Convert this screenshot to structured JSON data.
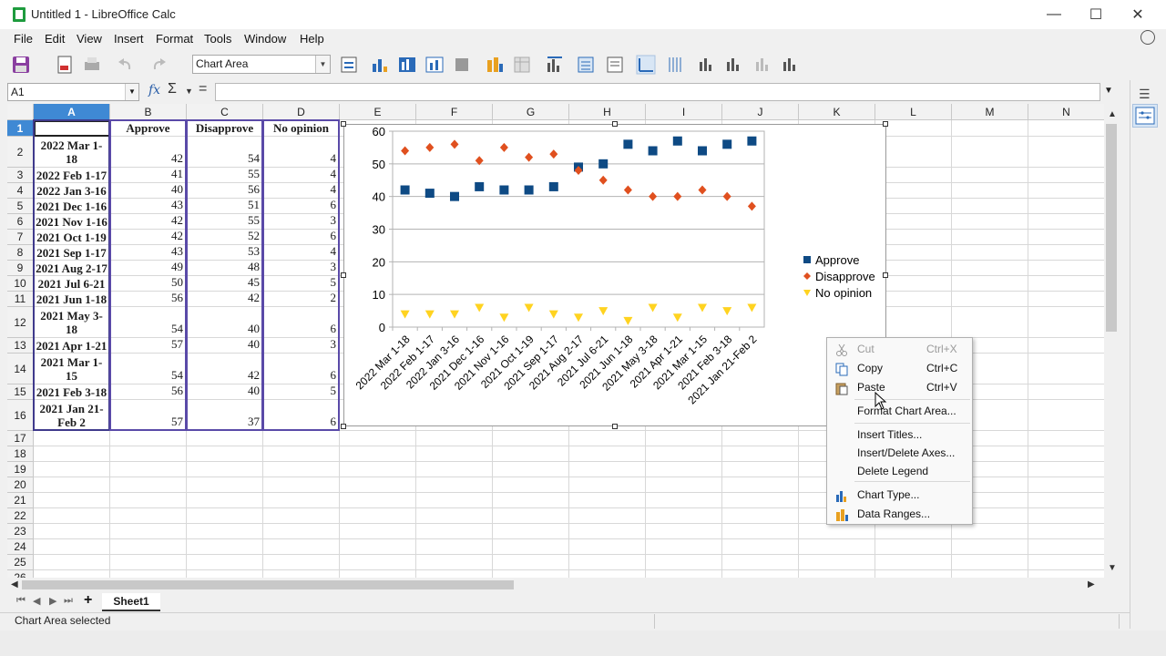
{
  "window": {
    "title": "Untitled 1 - LibreOffice Calc"
  },
  "menu": [
    "File",
    "Edit",
    "View",
    "Insert",
    "Format",
    "Tools",
    "Window",
    "Help"
  ],
  "toolbar": {
    "chart_element_select": "Chart Area"
  },
  "formula": {
    "cell_ref": "A1",
    "fx": "fx",
    "sigma": "Σ",
    "eq": "=",
    "content": ""
  },
  "columns": [
    "A",
    "B",
    "C",
    "D",
    "E",
    "F",
    "G",
    "H",
    "I",
    "J",
    "K",
    "L",
    "M",
    "N"
  ],
  "rows": [
    "1",
    "2",
    "3",
    "4",
    "5",
    "6",
    "7",
    "8",
    "9",
    "10",
    "11",
    "12",
    "13",
    "14",
    "15",
    "16",
    "17",
    "18",
    "19",
    "20",
    "21",
    "22",
    "23",
    "24",
    "25",
    "26"
  ],
  "table": {
    "headers": [
      "Approve",
      "Disapprove",
      "No opinion"
    ],
    "rows": [
      {
        "date": "2022 Mar 1-18",
        "approve": "42",
        "disapprove": "54",
        "no_opinion": "4"
      },
      {
        "date": "2022 Feb 1-17",
        "approve": "41",
        "disapprove": "55",
        "no_opinion": "4"
      },
      {
        "date": "2022 Jan 3-16",
        "approve": "40",
        "disapprove": "56",
        "no_opinion": "4"
      },
      {
        "date": "2021 Dec 1-16",
        "approve": "43",
        "disapprove": "51",
        "no_opinion": "6"
      },
      {
        "date": "2021 Nov 1-16",
        "approve": "42",
        "disapprove": "55",
        "no_opinion": "3"
      },
      {
        "date": "2021 Oct 1-19",
        "approve": "42",
        "disapprove": "52",
        "no_opinion": "6"
      },
      {
        "date": "2021 Sep 1-17",
        "approve": "43",
        "disapprove": "53",
        "no_opinion": "4"
      },
      {
        "date": "2021 Aug 2-17",
        "approve": "49",
        "disapprove": "48",
        "no_opinion": "3"
      },
      {
        "date": "2021 Jul 6-21",
        "approve": "50",
        "disapprove": "45",
        "no_opinion": "5"
      },
      {
        "date": "2021 Jun 1-18",
        "approve": "56",
        "disapprove": "42",
        "no_opinion": "2"
      },
      {
        "date": "2021 May 3-18",
        "approve": "54",
        "disapprove": "40",
        "no_opinion": "6"
      },
      {
        "date": "2021 Apr 1-21",
        "approve": "57",
        "disapprove": "40",
        "no_opinion": "3"
      },
      {
        "date": "2021 Mar 1-15",
        "approve": "54",
        "disapprove": "42",
        "no_opinion": "6"
      },
      {
        "date": "2021 Feb 3-18",
        "approve": "56",
        "disapprove": "40",
        "no_opinion": "5"
      },
      {
        "date": "2021 Jan 21-Feb 2",
        "approve": "57",
        "disapprove": "37",
        "no_opinion": "6"
      }
    ]
  },
  "chart_data": {
    "type": "scatter",
    "categories": [
      "2022 Mar 1-18",
      "2022 Feb 1-17",
      "2022 Jan 3-16",
      "2021 Dec 1-16",
      "2021 Nov 1-16",
      "2021 Oct 1-19",
      "2021 Sep 1-17",
      "2021 Aug 2-17",
      "2021 Jul 6-21",
      "2021 Jun 1-18",
      "2021 May 3-18",
      "2021 Apr 1-21",
      "2021 Mar 1-15",
      "2021 Feb 3-18",
      "2021 Jan 21-Feb 2"
    ],
    "series": [
      {
        "name": "Approve",
        "values": [
          42,
          41,
          40,
          43,
          42,
          42,
          43,
          49,
          50,
          56,
          54,
          57,
          54,
          56,
          57
        ],
        "color": "#0e4a84",
        "marker": "square"
      },
      {
        "name": "Disapprove",
        "values": [
          54,
          55,
          56,
          51,
          55,
          52,
          53,
          48,
          45,
          42,
          40,
          40,
          42,
          40,
          37
        ],
        "color": "#e0501f",
        "marker": "diamond"
      },
      {
        "name": "No opinion",
        "values": [
          4,
          4,
          4,
          6,
          3,
          6,
          4,
          3,
          5,
          2,
          6,
          3,
          6,
          5,
          6
        ],
        "color": "#ffd320",
        "marker": "triangle-down"
      }
    ],
    "yticks": [
      0,
      10,
      20,
      30,
      40,
      50,
      60
    ],
    "ylim": [
      0,
      60
    ],
    "grid": true,
    "legend": "right"
  },
  "context_menu": {
    "items": [
      {
        "label": "Cut",
        "shortcut": "Ctrl+X",
        "icon": "cut-icon",
        "disabled": true
      },
      {
        "label": "Copy",
        "shortcut": "Ctrl+C",
        "icon": "copy-icon",
        "disabled": false
      },
      {
        "label": "Paste",
        "shortcut": "Ctrl+V",
        "icon": "paste-icon",
        "disabled": false
      },
      {
        "label": "Format Chart Area...",
        "shortcut": "",
        "icon": "",
        "disabled": false
      },
      {
        "label": "Insert Titles...",
        "shortcut": "",
        "icon": "",
        "disabled": false
      },
      {
        "label": "Insert/Delete Axes...",
        "shortcut": "",
        "icon": "",
        "disabled": false
      },
      {
        "label": "Delete Legend",
        "shortcut": "",
        "icon": "",
        "disabled": false
      },
      {
        "label": "Chart Type...",
        "shortcut": "",
        "icon": "chart-type-icon",
        "disabled": false
      },
      {
        "label": "Data Ranges...",
        "shortcut": "",
        "icon": "data-ranges-icon",
        "disabled": false
      }
    ]
  },
  "sheet_tabs": [
    "Sheet1"
  ],
  "status": {
    "text": "Chart Area selected"
  },
  "colors": {
    "accent": "#3f89d4",
    "range_border": "#5a4aa8"
  }
}
